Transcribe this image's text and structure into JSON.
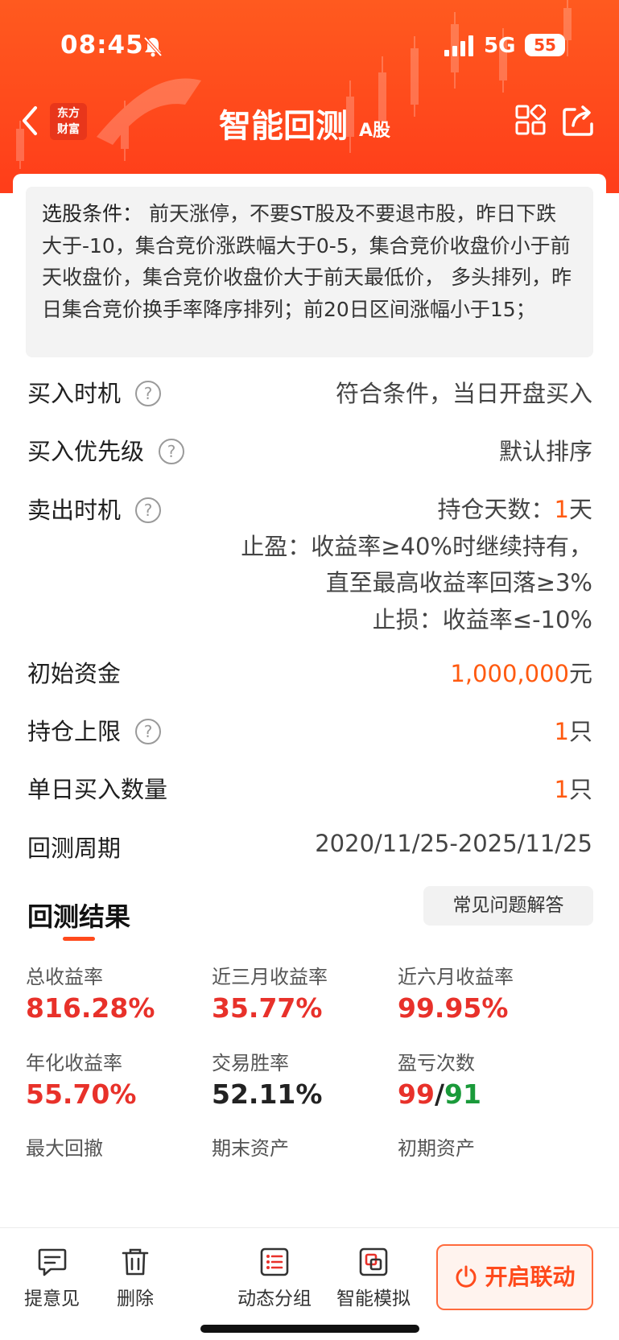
{
  "status_bar": {
    "time": "08:45",
    "network": "5G",
    "battery": "55"
  },
  "nav": {
    "logo_line1": "东方",
    "logo_line2": "财富",
    "title": "智能回测",
    "title_tag": "A股"
  },
  "conditions": {
    "label": "选股条件：",
    "text": " 前天涨停，不要ST股及不要退市股，昨日下跌大于-10，集合竞价涨跌幅大于0-5，集合竞价收盘价小于前天收盘价，集合竞价收盘价大于前天最低价， 多头排列，昨日集合竞价换手率降序排列；前20日区间涨幅小于15；"
  },
  "settings": {
    "buy_timing": {
      "label": "买入时机",
      "value": "符合条件，当日开盘买入"
    },
    "buy_priority": {
      "label": "买入优先级",
      "value": "默认排序"
    },
    "sell_timing": {
      "label": "卖出时机",
      "hold_prefix": "持仓天数：",
      "hold_days": "1",
      "hold_unit": "天",
      "take_profit_1": "止盈：收益率≥40%时继续持有，",
      "take_profit_2": "直至最高收益率回落≥3%",
      "stop_loss": "止损：收益率≤-10%"
    },
    "initial_capital": {
      "label": "初始资金",
      "value": "1,000,000",
      "unit": "元"
    },
    "position_limit": {
      "label": "持仓上限",
      "value": "1",
      "unit": "只"
    },
    "daily_buy_count": {
      "label": "单日买入数量",
      "value": "1",
      "unit": "只"
    },
    "backtest_period": {
      "label": "回测周期",
      "value": "2020/11/25-2025/11/25"
    }
  },
  "results": {
    "title": "回测结果",
    "faq_button": "常见问题解答",
    "total_return": {
      "label": "总收益率",
      "value": "816.28%"
    },
    "three_month_return": {
      "label": "近三月收益率",
      "value": "35.77%"
    },
    "six_month_return": {
      "label": "近六月收益率",
      "value": "99.95%"
    },
    "annualized_return": {
      "label": "年化收益率",
      "value": "55.70%"
    },
    "win_rate": {
      "label": "交易胜率",
      "value": "52.11%"
    },
    "win_loss_count": {
      "label": "盈亏次数",
      "wins": "99",
      "sep": "/",
      "losses": "91"
    },
    "max_drawdown": {
      "label": "最大回撤"
    },
    "final_assets": {
      "label": "期末资产"
    },
    "initial_assets": {
      "label": "初期资产"
    }
  },
  "bottom_bar": {
    "feedback": "提意见",
    "delete": "删除",
    "dynamic_group": "动态分组",
    "smart_simulation": "智能模拟",
    "enable_linkage": "开启联动"
  },
  "colors": {
    "accent": "#ff4a1c",
    "orange_value": "#ff5a10",
    "gain": "#e8312a",
    "loss": "#1a9a3a"
  }
}
